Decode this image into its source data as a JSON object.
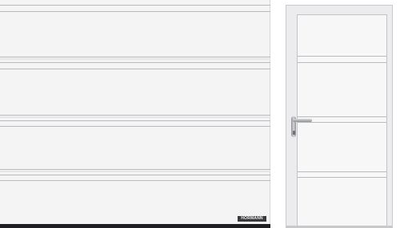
{
  "scene": {
    "garage_door": {
      "logo_text": "HÖRMANN"
    }
  },
  "colors": {
    "door_white": "#f4f4f5",
    "groove": "#b9babd",
    "floor_dark": "#1f1f21",
    "handle_steel": "#b0b2b6"
  },
  "icons": {
    "door_handle": "door-handle-icon",
    "keyhole": "keyhole-icon"
  }
}
